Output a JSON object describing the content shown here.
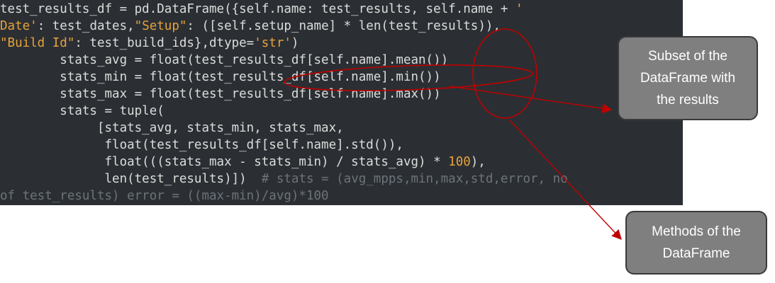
{
  "code_lines": [
    [
      {
        "t": "test_results_df = pd.DataFrame({self.name: test_results, self.name + "
      },
      {
        "t": "'",
        "k": "str"
      }
    ],
    [
      {
        "t": "Date'",
        "k": "str"
      },
      {
        "t": ": test_dates,"
      },
      {
        "t": "\"Setup\"",
        "k": "str"
      },
      {
        "t": ": ([self.setup_name] * len(test_results)),"
      }
    ],
    [
      {
        "t": "\"Build Id\"",
        "k": "str"
      },
      {
        "t": ": test_build_ids},dtype="
      },
      {
        "t": "'str'",
        "k": "str"
      },
      {
        "t": ")"
      }
    ],
    [
      {
        "t": "        stats_avg = float(test_results_df[self.name].mean())"
      }
    ],
    [
      {
        "t": "        stats_min = float(test_results_df[self.name].min())"
      }
    ],
    [
      {
        "t": "        stats_max = float(test_results_df[self.name].max())"
      }
    ],
    [
      {
        "t": "        stats = tuple("
      }
    ],
    [
      {
        "t": "             [stats_avg, stats_min, stats_max,"
      }
    ],
    [
      {
        "t": "              float(test_results_df[self.name].std()),"
      }
    ],
    [
      {
        "t": "              float(((stats_max - stats_min) / stats_avg) * "
      },
      {
        "t": "100",
        "k": "num"
      },
      {
        "t": "),"
      }
    ],
    [
      {
        "t": "              len(test_results)])  "
      },
      {
        "t": "# stats = (avg_mpps,min,max,std,error, no",
        "k": "cmt"
      }
    ],
    [
      {
        "t": "of test_results) error = ((max-min)/avg)*100",
        "k": "cmt"
      }
    ]
  ],
  "callouts": {
    "subset": "Subset of the\nDataFrame with\nthe results",
    "methods": "Methods of the\nDataFrame"
  },
  "colors": {
    "code_background": "#2b2f33",
    "code_text": "#dcdcdc",
    "string": "#e6a23c",
    "comment": "#6c737a",
    "annotation": "#c00000",
    "callout_fill": "#7f7f7f"
  }
}
